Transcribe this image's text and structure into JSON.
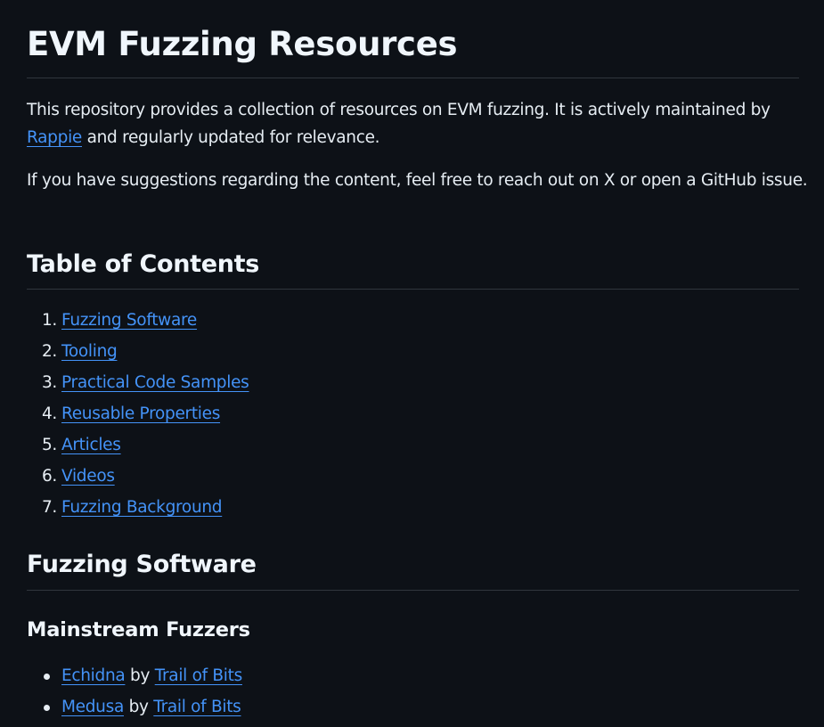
{
  "title": "EVM Fuzzing Resources",
  "intro": {
    "text_before": "This repository provides a collection of resources on EVM fuzzing. It is actively maintained by ",
    "link": "Rappie",
    "text_after": " and regularly updated for relevance."
  },
  "suggestions": "If you have suggestions regarding the content, feel free to reach out on X or open a GitHub issue.",
  "toc": {
    "heading": "Table of Contents",
    "items": [
      {
        "number": "1.",
        "label": "Fuzzing Software"
      },
      {
        "number": "2.",
        "label": "Tooling"
      },
      {
        "number": "3.",
        "label": "Practical Code Samples"
      },
      {
        "number": "4.",
        "label": "Reusable Properties"
      },
      {
        "number": "5.",
        "label": "Articles"
      },
      {
        "number": "6.",
        "label": "Videos"
      },
      {
        "number": "7.",
        "label": "Fuzzing Background"
      }
    ]
  },
  "fuzzing_software": {
    "heading": "Fuzzing Software",
    "mainstream": {
      "heading": "Mainstream Fuzzers",
      "items": [
        {
          "tool": "Echidna",
          "by": "by",
          "author": "Trail of Bits"
        },
        {
          "tool": "Medusa",
          "by": "by",
          "author": "Trail of Bits"
        }
      ]
    }
  }
}
